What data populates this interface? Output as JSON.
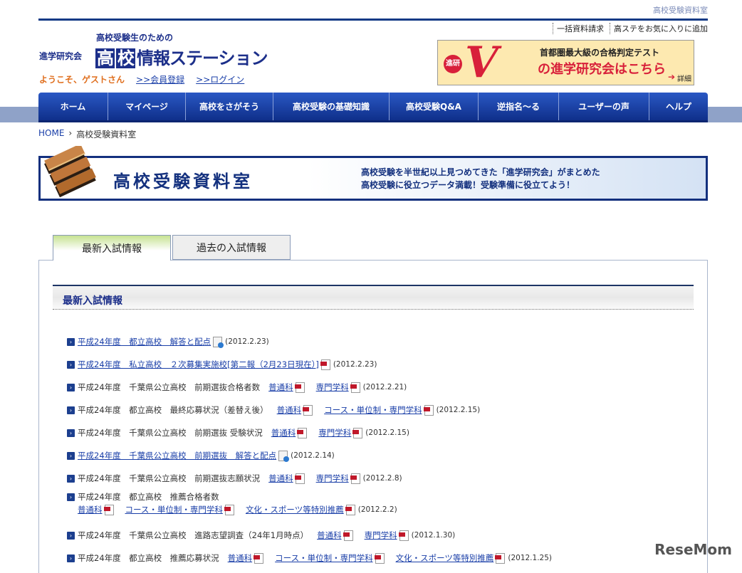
{
  "header": {
    "page_label": "高校受験資料室",
    "links": [
      "一括資料請求",
      "高ステをお気に入りに追加"
    ],
    "logo_sub": "高校受験生のための",
    "logo_org": "進学研究会",
    "logo_box1": "高",
    "logo_box2": "校",
    "logo_rest": "情報ステーション",
    "welcome": "ようこそ、ゲストさん",
    "register": ">>会員登録",
    "login": ">>ログイン"
  },
  "ad": {
    "badge": "進研",
    "v": "V",
    "line1": "首都圏最大級の合格判定テスト",
    "line2": "の進学研究会はこちら",
    "more": "詳細"
  },
  "nav": [
    "ホーム",
    "マイページ",
    "高校をさがそう",
    "高校受験の基礎知識",
    "高校受験Q&A",
    "逆指名〜る",
    "ユーザーの声",
    "ヘルプ"
  ],
  "breadcrumb": {
    "home": "HOME",
    "sep": "›",
    "current": "高校受験資料室"
  },
  "banner": {
    "title": "高校受験資料室",
    "desc1": "高校受験を半世紀以上見つめてきた「進学研究会」がまとめた",
    "desc2": "高校受験に役立つデータ満載！受験準備に役立てよう！"
  },
  "tabs": [
    {
      "label": "最新入試情報",
      "active": true
    },
    {
      "label": "過去の入試情報",
      "active": false
    }
  ],
  "section_title": "最新入試情報",
  "rows": [
    {
      "title": "平成24年度　都立高校　解答と配点",
      "title_link": true,
      "title_icon": "doc",
      "links": [],
      "date": "(2012.2.23)"
    },
    {
      "title": "平成24年度　私立高校　２次募集実施校[第二報（2月23日現在）]",
      "title_link": true,
      "title_icon": "pdf",
      "links": [],
      "date": "(2012.2.23)"
    },
    {
      "title": "平成24年度　千葉県公立高校　前期選抜合格者数",
      "title_link": false,
      "links": [
        "普通科",
        "専門学科"
      ],
      "date": "(2012.2.21)"
    },
    {
      "title": "平成24年度　都立高校　最終応募状況（差替え後）",
      "title_link": false,
      "links": [
        "普通科",
        "コース・単位制・専門学科"
      ],
      "date": "(2012.2.15)"
    },
    {
      "title": "平成24年度　千葉県公立高校　前期選抜 受験状況",
      "title_link": false,
      "links": [
        "普通科",
        "専門学科"
      ],
      "date": "(2012.2.15)"
    },
    {
      "title": "平成24年度　千葉県公立高校　前期選抜　解答と配点",
      "title_link": true,
      "title_icon": "doc",
      "links": [],
      "date": "(2012.2.14)"
    },
    {
      "title": "平成24年度　千葉県公立高校　前期選抜志願状況",
      "title_link": false,
      "links": [
        "普通科",
        "専門学科"
      ],
      "date": "(2012.2.8)"
    },
    {
      "title": "平成24年度　都立高校　推薦合格者数",
      "title_link": false,
      "wrap": true,
      "links": [
        "普通科",
        "コース・単位制・専門学科",
        "文化・スポーツ等特別推薦"
      ],
      "date": "(2012.2.2)"
    },
    {
      "title": "平成24年度　千葉県公立高校　進路志望調査（24年1月時点）",
      "title_link": false,
      "links": [
        "普通科",
        "専門学科"
      ],
      "date": "(2012.1.30)"
    },
    {
      "title": "平成24年度　都立高校　推薦応募状況",
      "title_link": false,
      "links": [
        "普通科",
        "コース・単位制・専門学科",
        "文化・スポーツ等特別推薦"
      ],
      "date": "(2012.1.25)"
    }
  ],
  "watermark": "ReseMom"
}
